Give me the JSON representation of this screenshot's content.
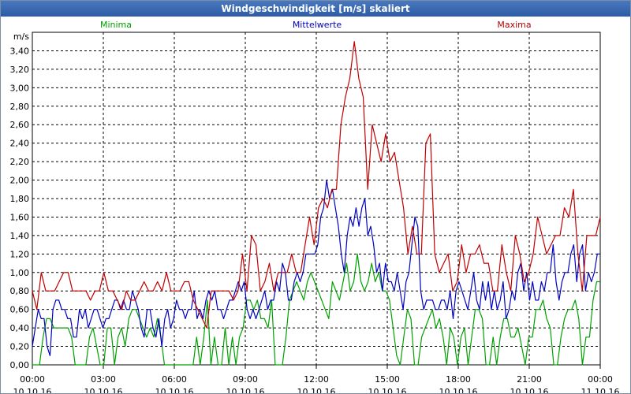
{
  "window": {
    "title": "Windgeschwindigkeit [m/s] skaliert"
  },
  "chart_data": {
    "type": "line",
    "title": "Windgeschwindigkeit [m/s] skaliert",
    "ylabel": "m/s",
    "xlabel": "",
    "ylim": [
      0,
      3.6
    ],
    "grid": true,
    "legend_placement": "top",
    "y_ticks": [
      "0,00",
      "0,20",
      "0,40",
      "0,60",
      "0,80",
      "1,00",
      "1,20",
      "1,40",
      "1,60",
      "1,80",
      "2,00",
      "2,20",
      "2,40",
      "2,60",
      "2,80",
      "3,00",
      "3,20",
      "3,40"
    ],
    "x_ticks": [
      {
        "time": "00:00",
        "date": "10.10.16"
      },
      {
        "time": "03:00",
        "date": "10.10.16"
      },
      {
        "time": "06:00",
        "date": "10.10.16"
      },
      {
        "time": "09:00",
        "date": "10.10.16"
      },
      {
        "time": "12:00",
        "date": "10.10.16"
      },
      {
        "time": "15:00",
        "date": "10.10.16"
      },
      {
        "time": "18:00",
        "date": "10.10.16"
      },
      {
        "time": "21:00",
        "date": "10.10.16"
      },
      {
        "time": "00:00",
        "date": "11.10.16"
      }
    ],
    "x_hours": [
      0,
      0.2,
      0.4,
      0.6,
      0.8,
      1,
      1.2,
      1.4,
      1.6,
      1.8,
      2,
      2.2,
      2.4,
      2.6,
      2.8,
      3,
      3.2,
      3.4,
      3.6,
      3.8,
      4,
      4.2,
      4.4,
      4.6,
      4.8,
      5,
      5.2,
      5.4,
      5.6,
      5.8,
      6,
      6.2,
      6.4,
      6.6,
      6.8,
      7,
      7.2,
      7.4,
      7.6,
      7.8,
      8,
      8.2,
      8.4,
      8.6,
      8.8,
      9,
      9.2,
      9.4,
      9.6,
      9.8,
      10,
      10.2,
      10.4,
      10.6,
      10.8,
      11,
      11.2,
      11.4,
      11.6,
      11.8,
      12,
      12.2,
      12.4,
      12.6,
      12.8,
      13,
      13.2,
      13.4,
      13.6,
      13.8,
      14,
      14.2,
      14.4,
      14.6,
      14.8,
      15,
      15.2,
      15.4,
      15.6,
      15.8,
      16,
      16.2,
      16.4,
      16.6,
      16.8,
      17,
      17.2,
      17.4,
      17.6,
      17.8,
      18,
      18.2,
      18.4,
      18.6,
      18.8,
      19,
      19.2,
      19.4,
      19.6,
      19.8,
      20,
      20.2,
      20.4,
      20.6,
      20.8,
      21,
      21.2,
      21.4,
      21.6,
      21.8,
      22,
      22.2,
      22.4,
      22.6,
      22.8,
      23,
      23.2,
      23.4,
      23.6,
      23.8,
      24
    ],
    "series": [
      {
        "name": "Minima",
        "color": "#00a000",
        "values": [
          0,
          0,
          0,
          0.3,
          0.5,
          0.5,
          0.4,
          0.4,
          0.4,
          0.4,
          0.4,
          0.3,
          0,
          0,
          0,
          0,
          0.3,
          0.4,
          0.2,
          0,
          0,
          0.4,
          0.4,
          0,
          0.3,
          0.4,
          0.2,
          0.5,
          0.6,
          0.6,
          0.5,
          0.4,
          0.3,
          0.4,
          0.3,
          0.5,
          0.3,
          0,
          0,
          0,
          0,
          0,
          0,
          0,
          0,
          0,
          0.3,
          0,
          0.3,
          0.7,
          0,
          0.3,
          0,
          0,
          0.4,
          0,
          0.3,
          0,
          0.3,
          0.4,
          0.7,
          0.7,
          0.6,
          0.7,
          0.5,
          0.5,
          0.4,
          0.7,
          0,
          0,
          0,
          0.3,
          0.7,
          0.8,
          0.9,
          0.8,
          0.7,
          0.9,
          1,
          0.9,
          0.8,
          0.7,
          0.6,
          0.5,
          0.9,
          0.8,
          0.7,
          0.9,
          1.1,
          0.8,
          0.9,
          1.2,
          0.9,
          0.8,
          0.9,
          1.1,
          0.9,
          1,
          0.8,
          0.8,
          0.7,
          0.4,
          0.1,
          0,
          0.3,
          0.6,
          0.5,
          0,
          0,
          0.3,
          0.4,
          0.5,
          0.6,
          0.4,
          0.5,
          0.3,
          0,
          0.4,
          0.3,
          0,
          0.3,
          0.4,
          0,
          0.3,
          0.6,
          0.6,
          0.5,
          0,
          0,
          0.3,
          0,
          0.3,
          0.5,
          0.5,
          0.3,
          0.3,
          0.4,
          0.2,
          0,
          0.3,
          0.3,
          0.6,
          0.6,
          0.7,
          0.5,
          0.4,
          0,
          0,
          0.3,
          0.5,
          0.6,
          0.6,
          0.7,
          0.5,
          0,
          0.3,
          0.3,
          0.7,
          0.9,
          0.9
        ],
        "note_count_check": ""
      },
      {
        "name": "Mittelwerte",
        "color": "#0000c0",
        "values": [
          0.2,
          0.4,
          0.6,
          0.5,
          0.5,
          0.2,
          0.1,
          0.6,
          0.7,
          0.7,
          0.6,
          0.6,
          0.5,
          0.5,
          0.3,
          0.3,
          0.6,
          0.5,
          0.6,
          0.4,
          0.5,
          0.6,
          0.6,
          0.5,
          0.4,
          0.5,
          0.5,
          0.6,
          0.7,
          0.7,
          0.6,
          0.7,
          0.6,
          0.6,
          0.8,
          0.7,
          0.6,
          0.4,
          0.3,
          0.6,
          0.6,
          0.4,
          0.3,
          0.5,
          0.2,
          0.5,
          0.6,
          0.4,
          0.5,
          0.7,
          0.6,
          0.6,
          0.5,
          0.6,
          0.6,
          0.8,
          0.5,
          0.6,
          0.5,
          0.7,
          0.8,
          0.7,
          0.8,
          0.6,
          0.6,
          0.5,
          0.6,
          0.7,
          0.7,
          0.8,
          0.9,
          0.8,
          0.9,
          0.6,
          0.5,
          0.6,
          0.5,
          0.6,
          0.7,
          0.8,
          0.6,
          0.7,
          0.7,
          0.9,
          0.8,
          1.1,
          1.0,
          0.7,
          0.7,
          0.9,
          1.0,
          0.9,
          1.0,
          1.2,
          1.2,
          1.2,
          1.2,
          1.3,
          1.6,
          1.7,
          2.0,
          1.8,
          1.9,
          1.7,
          1.5,
          1.2,
          1.0,
          1.4,
          1.6,
          1.5,
          1.7,
          1.5,
          1.7,
          1.8,
          1.4,
          1.5,
          1.3,
          1.0,
          1.1,
          0.8,
          1.1,
          0.9,
          0.9,
          0.8,
          1.0,
          0.8,
          0.6,
          0.9,
          1.0,
          1.3,
          1.6,
          1.5,
          0.8,
          0.6,
          0.7,
          0.7,
          0.7,
          0.6,
          0.6,
          0.7,
          0.7,
          0.6,
          0.8,
          0.5,
          0.8,
          0.9,
          0.8,
          0.7,
          0.6,
          0.8,
          1.0,
          0.7,
          0.6,
          0.9,
          0.7,
          0.9,
          0.6,
          0.8,
          0.6,
          0.7,
          0.9,
          0.5,
          0.6,
          0.8,
          0.7,
          1.0,
          1.1,
          0.8,
          1.0,
          0.7,
          0.9,
          0.7,
          0.7,
          0.9,
          0.8,
          1.0,
          1.0,
          1.3,
          0.9,
          0.7,
          0.9,
          1.0,
          1.0,
          1.2,
          1.3,
          0.9,
          1.2,
          1.3,
          0.8,
          1.0,
          0.9,
          1.0,
          1.2,
          1.2
        ],
        "note_count_check": ""
      },
      {
        "name": "Maxima",
        "color": "#c00000",
        "values": [
          0.8,
          0.6,
          1.0,
          0.8,
          0.8,
          0.8,
          0.9,
          1.0,
          1.0,
          0.8,
          0.8,
          0.8,
          0.8,
          0.7,
          0.8,
          0.8,
          1.0,
          0.8,
          0.8,
          0.7,
          0.6,
          0.8,
          0.7,
          0.7,
          0.8,
          0.9,
          0.8,
          0.8,
          0.9,
          0.8,
          1.0,
          0.8,
          0.8,
          0.8,
          0.9,
          0.9,
          0.7,
          0.6,
          0.5,
          0.4,
          0.8,
          0.8,
          0.8,
          0.8,
          0.8,
          0.7,
          0.8,
          1.2,
          0.8,
          1.4,
          1.3,
          0.8,
          0.9,
          1.1,
          0.8,
          1.0,
          1.0,
          1.0,
          1.2,
          1.0,
          1.0,
          1.3,
          1.6,
          1.3,
          1.7,
          1.8,
          1.7,
          1.9,
          1.9,
          2.6,
          2.9,
          3.1,
          3.5,
          3.1,
          2.9,
          1.9,
          2.6,
          2.4,
          2.2,
          2.5,
          2.2,
          2.3,
          2.0,
          1.7,
          1.2,
          1.5,
          1.2,
          1.2,
          2.4,
          2.5,
          1.2,
          1.0,
          1.1,
          1.2,
          0.8,
          0.9,
          1.3,
          1.0,
          1.2,
          1.2,
          1.3,
          1.1,
          1.1,
          0.8,
          0.8,
          1.3,
          1.0,
          0.8,
          1.4,
          1.2,
          0.9,
          1.0,
          1.2,
          1.6,
          1.4,
          1.2,
          1.3,
          1.4,
          1.4,
          1.7,
          1.6,
          1.9,
          1.2,
          0.8,
          1.4,
          1.4,
          1.4,
          1.6
        ],
        "note_count_check": ""
      }
    ]
  }
}
